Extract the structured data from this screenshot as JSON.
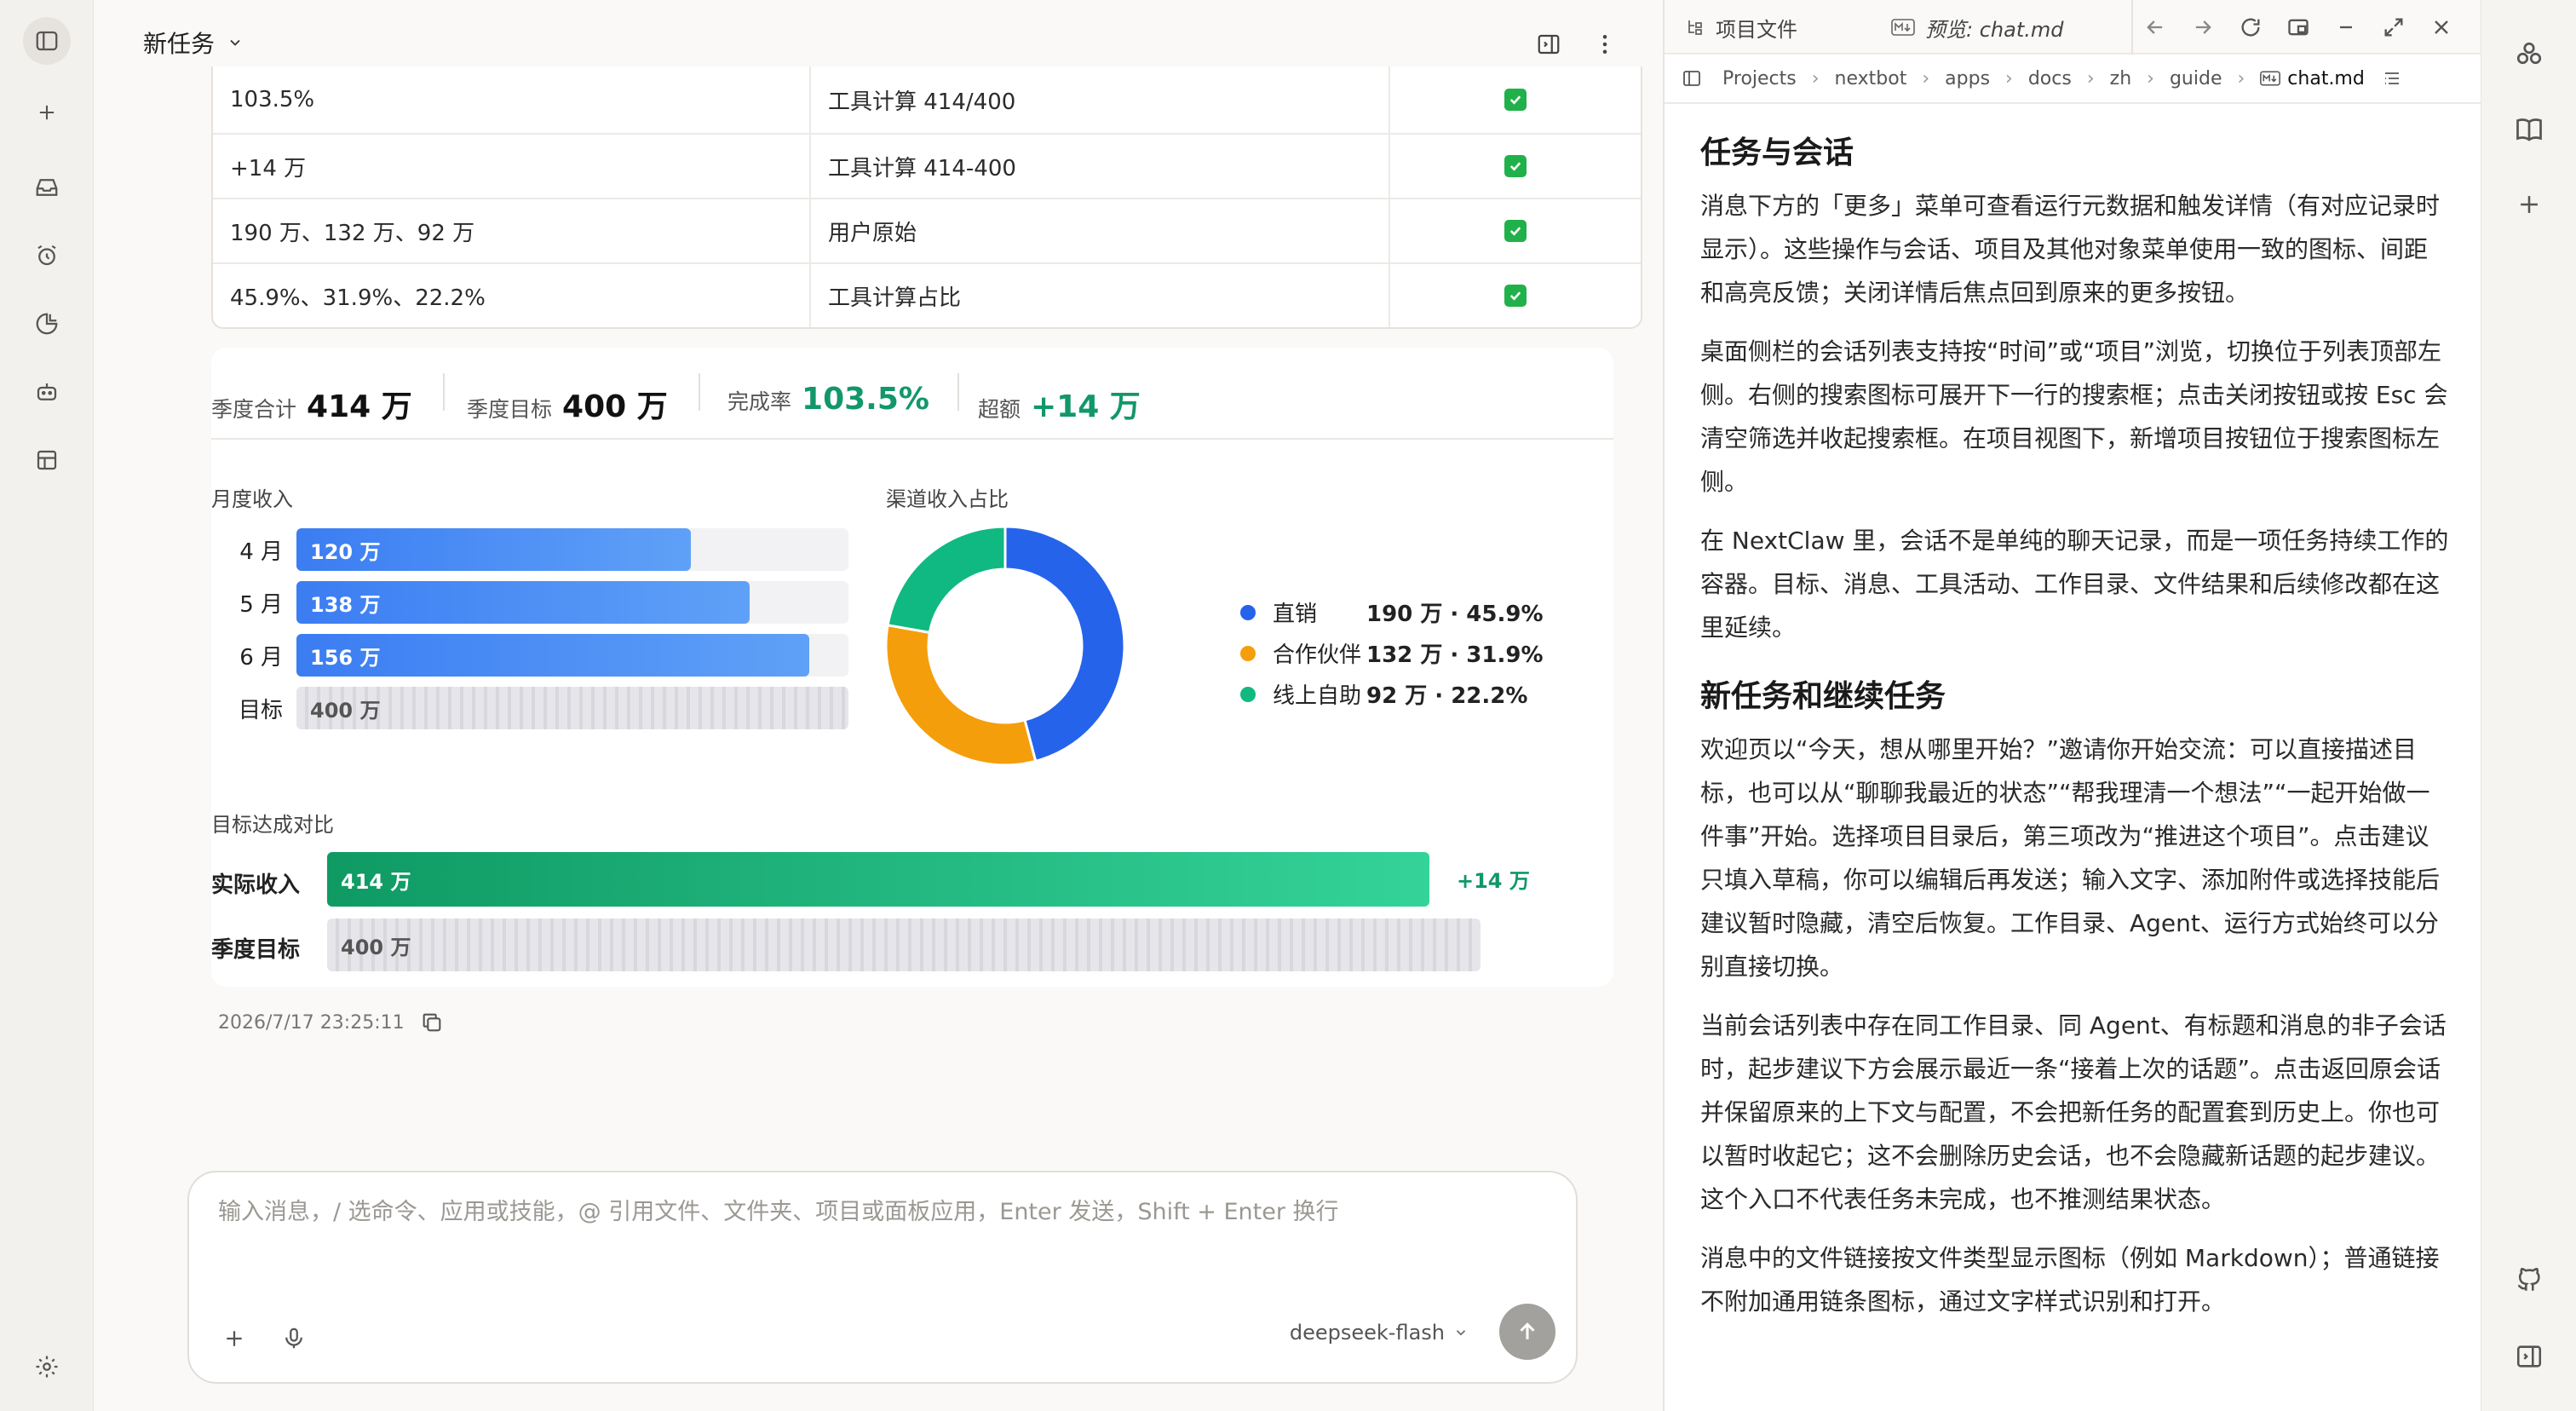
{
  "main": {
    "title": "新任务",
    "table": [
      {
        "value": "103.5%",
        "source": "工具计算 414/400"
      },
      {
        "value": "+14 万",
        "source": "工具计算 414-400"
      },
      {
        "value": "190 万、132 万、92 万",
        "source": "用户原始"
      },
      {
        "value": "45.9%、31.9%、22.2%",
        "source": "工具计算占比"
      }
    ],
    "kpis": [
      {
        "label": "季度合计",
        "value": "414 万"
      },
      {
        "label": "季度目标",
        "value": "400 万"
      },
      {
        "label": "完成率",
        "value": "103.5%"
      },
      {
        "label": "超额",
        "value": "+14 万"
      }
    ],
    "monthly_title": "月度收入",
    "channel_title": "渠道收入占比",
    "compare_title": "目标达成对比",
    "compare": {
      "actual_label": "实际收入",
      "actual_value": "414 万",
      "over": "+14 万",
      "target_label": "季度目标",
      "target_value": "400 万"
    },
    "timestamp": "2026/7/17 23:25:11",
    "composer_placeholder": "输入消息，/ 选命令、应用或技能，@ 引用文件、文件夹、项目或面板应用，Enter 发送，Shift + Enter 换行",
    "model": "deepseek-flash"
  },
  "chart_data": [
    {
      "type": "bar",
      "title": "月度收入",
      "categories": [
        "4 月",
        "5 月",
        "6 月",
        "目标"
      ],
      "values": [
        120,
        138,
        156,
        400
      ],
      "value_labels": [
        "120 万",
        "138 万",
        "156 万",
        "400 万"
      ],
      "xlim": [
        0,
        168
      ]
    },
    {
      "type": "pie",
      "title": "渠道收入占比",
      "labels": [
        "直销",
        "合作伙伴",
        "线上自助"
      ],
      "values": [
        190,
        132,
        92
      ],
      "value_labels": [
        "190 万 · 45.9%",
        "132 万 · 31.9%",
        "92 万 · 22.2%"
      ],
      "colors": [
        "#2563eb",
        "#f59e0b",
        "#10b981"
      ]
    },
    {
      "type": "bar",
      "title": "目标达成对比",
      "categories": [
        "实际收入",
        "季度目标"
      ],
      "values": [
        414,
        400
      ],
      "value_labels": [
        "414 万",
        "400 万"
      ]
    }
  ],
  "preview": {
    "tab_files": "项目文件",
    "tab_preview": "预览: chat.md",
    "breadcrumbs": [
      "Projects",
      "nextbot",
      "apps",
      "docs",
      "zh",
      "guide",
      "chat.md"
    ],
    "h1": "任务与会话",
    "p1": "消息下方的「更多」菜单可查看运行元数据和触发详情（有对应记录时显示）。这些操作与会话、项目及其他对象菜单使用一致的图标、间距和高亮反馈；关闭详情后焦点回到原来的更多按钮。",
    "p2": "桌面侧栏的会话列表支持按“时间”或“项目”浏览，切换位于列表顶部左侧。右侧的搜索图标可展开下一行的搜索框；点击关闭按钮或按 Esc 会清空筛选并收起搜索框。在项目视图下，新增项目按钮位于搜索图标左侧。",
    "p3": "在 NextClaw 里，会话不是单纯的聊天记录，而是一项任务持续工作的容器。目标、消息、工具活动、工作目录、文件结果和后续修改都在这里延续。",
    "h2": "新任务和继续任务",
    "p4": "欢迎页以“今天，想从哪里开始？”邀请你开始交流：可以直接描述目标，也可以从“聊聊我最近的状态”“帮我理清一个想法”“一起开始做一件事”开始。选择项目目录后，第三项改为“推进这个项目”。点击建议只填入草稿，你可以编辑后再发送；输入文字、添加附件或选择技能后建议暂时隐藏，清空后恢复。工作目录、Agent、运行方式始终可以分别直接切换。",
    "p5": "当前会话列表中存在同工作目录、同 Agent、有标题和消息的非子会话时，起步建议下方会展示最近一条“接着上次的话题”。点击返回原会话并保留原来的上下文与配置，不会把新任务的配置套到历史上。你也可以暂时收起它；这不会删除历史会话，也不会隐藏新话题的起步建议。这个入口不代表任务未完成，也不推测结果状态。",
    "p6": "消息中的文件链接按文件类型显示图标（例如 Markdown）；普通链接不附加通用链条图标，通过文字样式识别和打开。"
  }
}
